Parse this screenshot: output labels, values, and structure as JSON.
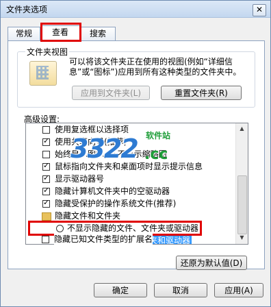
{
  "window": {
    "title": "文件夹选项",
    "close_glyph": "✕"
  },
  "tabs": [
    "常规",
    "查看",
    "搜索"
  ],
  "folder_views": {
    "group_label": "文件夹视图",
    "description": "可以将该文件夹正在使用的视图(例如“详细信息”或“图标”)应用到所有这种类型的文件夹中。",
    "apply_button": "应用到文件夹(L)",
    "reset_button": "重置文件夹(R)"
  },
  "advanced": {
    "label": "高级设置:",
    "items": [
      {
        "type": "checkbox",
        "checked": false,
        "label": "使用复选框以选择项"
      },
      {
        "type": "checkbox",
        "checked": true,
        "label": "使用共享向导(推荐)"
      },
      {
        "type": "checkbox",
        "checked": false,
        "label": "始终显示图标, 从不显示缩略图"
      },
      {
        "type": "checkbox",
        "checked": true,
        "label": "鼠标指向文件夹和桌面项时显示提示信息"
      },
      {
        "type": "checkbox",
        "checked": true,
        "label": "显示驱动器号"
      },
      {
        "type": "checkbox",
        "checked": true,
        "label": "隐藏计算机文件夹中的空驱动器"
      },
      {
        "type": "checkbox",
        "checked": true,
        "label": "隐藏受保护的操作系统文件(推荐)"
      },
      {
        "type": "folder",
        "label": "隐藏文件和文件夹"
      },
      {
        "type": "radio",
        "checked": false,
        "label": "不显示隐藏的文件、文件夹或驱动器"
      },
      {
        "type": "radio",
        "checked": true,
        "selected": true,
        "label": "显示隐藏的文件、文件夹和驱动器"
      },
      {
        "type": "checkbox",
        "checked": false,
        "label": "隐藏已知文件类型的扩展名"
      }
    ],
    "restore_button": "还原为默认值(D)"
  },
  "footer": {
    "ok": "确定",
    "cancel": "取消",
    "apply": "应用(A)"
  },
  "watermark": {
    "number": "3322",
    "domain": ".cc",
    "text": "软件站"
  },
  "colors": {
    "highlight_red": "#e00000",
    "selection_blue": "#3399ff"
  }
}
